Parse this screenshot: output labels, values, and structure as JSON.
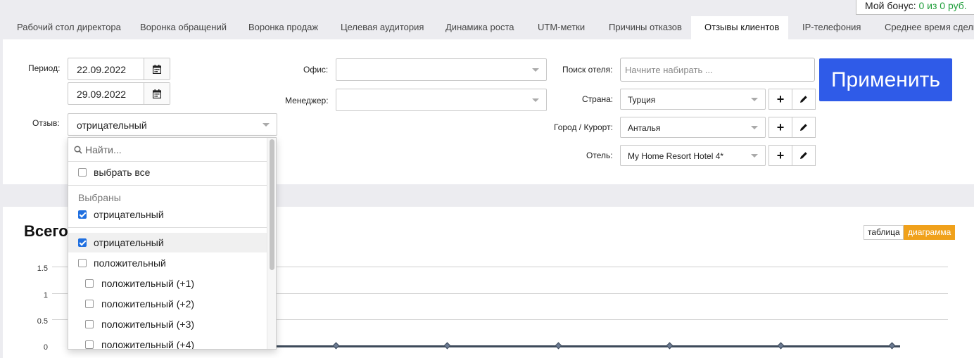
{
  "bonus": {
    "label": "Мой бонус:",
    "value": "0 из 0 руб."
  },
  "tabs": [
    "Рабочий стол директора",
    "Воронка обращений",
    "Воронка продаж",
    "Целевая аудитория",
    "Динамика роста",
    "UTM-метки",
    "Причины отказов",
    "Отзывы клиентов",
    "IP-телефония",
    "Среднее время сделки"
  ],
  "active_tab": "Отзывы клиентов",
  "filters": {
    "period_label": "Период:",
    "date_from": "22.09.2022",
    "date_to": "29.09.2022",
    "review_label": "Отзыв:",
    "review_value": "отрицательный",
    "office_label": "Офис:",
    "office_value": "",
    "manager_label": "Менеджер:",
    "manager_value": "",
    "hotel_search_label": "Поиск отеля:",
    "hotel_search_placeholder": "Начните набирать ...",
    "country_label": "Страна:",
    "country_value": "Турция",
    "city_label": "Город / Курорт:",
    "city_value": "Анталья",
    "hotel_label": "Отель:",
    "hotel_value": "My Home Resort Hotel 4*",
    "apply_label": "Применить"
  },
  "dropdown": {
    "search_placeholder": "Найти...",
    "select_all": "выбрать все",
    "selected_group": "Выбраны",
    "selected_items": [
      "отрицательный"
    ],
    "options": [
      {
        "label": "отрицательный",
        "checked": true,
        "indent": false
      },
      {
        "label": "положительный",
        "checked": false,
        "indent": false
      },
      {
        "label": "положительный (+1)",
        "checked": false,
        "indent": true
      },
      {
        "label": "положительный (+2)",
        "checked": false,
        "indent": true
      },
      {
        "label": "положительный (+3)",
        "checked": false,
        "indent": true
      },
      {
        "label": "положительный (+4)",
        "checked": false,
        "indent": true
      }
    ]
  },
  "chart": {
    "title_visible": "Всего",
    "toggle_table": "таблица",
    "toggle_chart": "диаграмма"
  },
  "chart_data": {
    "type": "line",
    "title": "Всего",
    "y_ticks": [
      "1.5",
      "1",
      "0.5",
      "0"
    ],
    "ylim": [
      0,
      1.5
    ],
    "series": [
      {
        "values": [
          0,
          0,
          0,
          0,
          0,
          0,
          0,
          0
        ]
      }
    ],
    "grid": true
  },
  "colors": {
    "apply_button": "#2f5be8",
    "toggle_active": "#f0a11b",
    "checkbox_on": "#1f6fe0",
    "bonus_value": "#1e9e3a"
  }
}
